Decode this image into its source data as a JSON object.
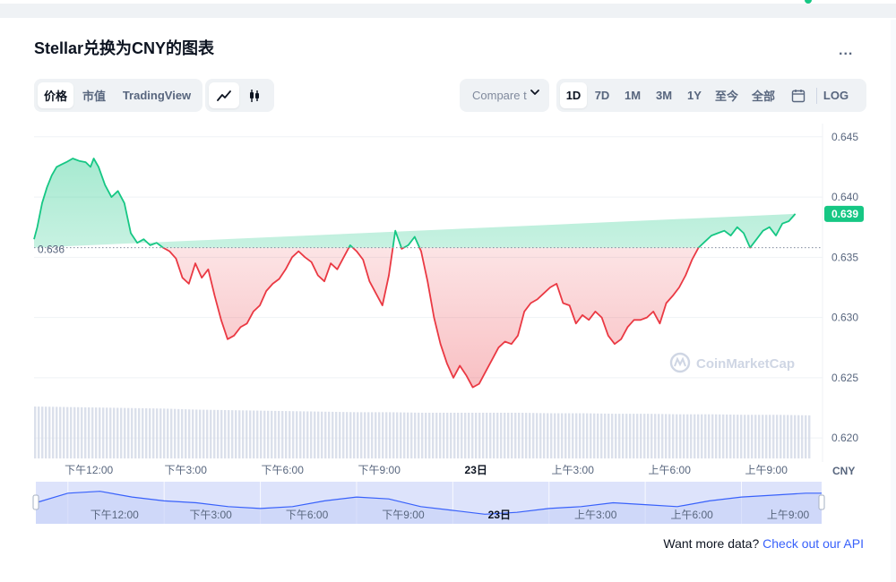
{
  "title": "Stellar兑换为CNY的图表",
  "more_label": "...",
  "view_tabs": [
    {
      "label": "价格",
      "active": true
    },
    {
      "label": "市值",
      "active": false
    },
    {
      "label": "TradingView",
      "active": false
    }
  ],
  "chart_type_icons": [
    "line-chart-icon",
    "candlestick-icon"
  ],
  "compare": {
    "label": "Compare t"
  },
  "range_tabs": [
    {
      "label": "1D",
      "active": true
    },
    {
      "label": "7D",
      "active": false
    },
    {
      "label": "1M",
      "active": false
    },
    {
      "label": "3M",
      "active": false
    },
    {
      "label": "1Y",
      "active": false
    },
    {
      "label": "至今",
      "active": false
    },
    {
      "label": "全部",
      "active": false
    }
  ],
  "log_label": "LOG",
  "footer": {
    "text": "Want more data?",
    "link": "Check out our API"
  },
  "watermark": "CoinMarketCap",
  "colors": {
    "up": "#16c784",
    "down": "#ea3943",
    "accent": "#3861fb",
    "volume": "#cfd6e4",
    "nav_fill": "#dde3fb"
  },
  "chart_data": {
    "type": "line",
    "currency_label": "CNY",
    "ylim": [
      0.6183,
      0.6461
    ],
    "yticks": [
      "0.645",
      "0.640",
      "0.635",
      "0.630",
      "0.625",
      "0.620"
    ],
    "ytick_values": [
      0.645,
      0.64,
      0.635,
      0.63,
      0.625,
      0.62
    ],
    "baseline": {
      "value": 0.6358,
      "label": "0.636"
    },
    "current": {
      "value": 0.6386,
      "label": "0.639"
    },
    "xticks": [
      "下午12:00",
      "下午3:00",
      "下午6:00",
      "下午9:00",
      "23日",
      "上午3:00",
      "上午6:00",
      "上午9:00"
    ],
    "xtick_hours": [
      1.7,
      4.7,
      7.7,
      10.7,
      13.7,
      16.7,
      19.7,
      22.7
    ],
    "x_hours_range": [
      0,
      24
    ],
    "price_x_hours": [
      0,
      0.1,
      0.25,
      0.4,
      0.55,
      0.7,
      0.85,
      1.0,
      1.2,
      1.4,
      1.6,
      1.75,
      1.85,
      2.0,
      2.2,
      2.4,
      2.6,
      2.8,
      3.0,
      3.2,
      3.4,
      3.6,
      3.8,
      4.0,
      4.2,
      4.4,
      4.6,
      4.8,
      5.0,
      5.2,
      5.4,
      5.6,
      5.8,
      6.0,
      6.2,
      6.4,
      6.6,
      6.8,
      7.0,
      7.2,
      7.4,
      7.6,
      7.8,
      8.0,
      8.2,
      8.4,
      8.6,
      8.8,
      9.0,
      9.2,
      9.4,
      9.6,
      9.8,
      10.0,
      10.2,
      10.4,
      10.6,
      10.8,
      11.0,
      11.2,
      11.4,
      11.6,
      11.8,
      12.0,
      12.2,
      12.4,
      12.6,
      12.8,
      13.0,
      13.2,
      13.4,
      13.6,
      13.8,
      14.0,
      14.2,
      14.4,
      14.6,
      14.8,
      15.0,
      15.2,
      15.4,
      15.6,
      15.8,
      16.0,
      16.2,
      16.4,
      16.6,
      16.8,
      17.0,
      17.2,
      17.4,
      17.6,
      17.8,
      18.0,
      18.2,
      18.4,
      18.6,
      18.8,
      19.0,
      19.2,
      19.4,
      19.6,
      19.8,
      20.0,
      20.2,
      20.4,
      20.6,
      20.8,
      21.0,
      21.2,
      21.4,
      21.6,
      21.8,
      22.0,
      22.2,
      22.4,
      22.6,
      22.8,
      23.0,
      23.2,
      23.4,
      23.6,
      23.8,
      24.0
    ],
    "price_values": [
      0.6365,
      0.6375,
      0.6395,
      0.6408,
      0.6418,
      0.6425,
      0.6427,
      0.6429,
      0.6432,
      0.643,
      0.6429,
      0.6425,
      0.6432,
      0.6425,
      0.641,
      0.64,
      0.6405,
      0.6395,
      0.637,
      0.6362,
      0.6365,
      0.636,
      0.6362,
      0.6358,
      0.6355,
      0.6349,
      0.6333,
      0.6328,
      0.6345,
      0.6333,
      0.634,
      0.6318,
      0.6298,
      0.6282,
      0.6285,
      0.6292,
      0.6295,
      0.6305,
      0.631,
      0.6322,
      0.6328,
      0.6332,
      0.634,
      0.635,
      0.6355,
      0.635,
      0.6346,
      0.6335,
      0.633,
      0.6345,
      0.634,
      0.635,
      0.636,
      0.6355,
      0.6348,
      0.633,
      0.632,
      0.631,
      0.6335,
      0.6372,
      0.6357,
      0.636,
      0.6367,
      0.6355,
      0.633,
      0.63,
      0.6278,
      0.6262,
      0.625,
      0.626,
      0.6252,
      0.6242,
      0.6245,
      0.6255,
      0.6265,
      0.6275,
      0.628,
      0.6278,
      0.6285,
      0.6305,
      0.6312,
      0.6315,
      0.632,
      0.6325,
      0.6328,
      0.6312,
      0.631,
      0.6295,
      0.6302,
      0.6298,
      0.6305,
      0.63,
      0.6285,
      0.6278,
      0.6282,
      0.6292,
      0.6298,
      0.6298,
      0.63,
      0.6305,
      0.6295,
      0.6312,
      0.6318,
      0.6325,
      0.6335,
      0.6348,
      0.6358,
      0.6363,
      0.6368,
      0.637,
      0.6372,
      0.6368,
      0.6375,
      0.637,
      0.6358,
      0.6365,
      0.6372,
      0.6375,
      0.6368,
      0.6378,
      0.638,
      0.6386
    ],
    "volume_x_hours": [
      0,
      1,
      2,
      3,
      4,
      5,
      6,
      7,
      8,
      9,
      10,
      11,
      12,
      13,
      14,
      15,
      16,
      17,
      18,
      19,
      20,
      21,
      22,
      23,
      24
    ],
    "volume_values": [
      1.0,
      0.99,
      0.98,
      0.97,
      0.96,
      0.94,
      0.93,
      0.92,
      0.91,
      0.9,
      0.89,
      0.89,
      0.88,
      0.88,
      0.88,
      0.88,
      0.87,
      0.87,
      0.86,
      0.86,
      0.85,
      0.85,
      0.84,
      0.84,
      0.83
    ],
    "navigator": {
      "xticks": [
        "下午12:00",
        "下午3:00",
        "下午6:00",
        "下午9:00",
        "23日",
        "上午3:00",
        "上午6:00",
        "上午9:00"
      ],
      "xtick_days": [
        0.5,
        3.5,
        6.5,
        9.5,
        12.5,
        15.5,
        18.5,
        21.5
      ],
      "x_days_range": [
        -0.5,
        24
      ],
      "x_days": [
        -0.5,
        0.5,
        1.5,
        2.5,
        3.5,
        4.5,
        5.5,
        6.5,
        7.5,
        8.5,
        9.5,
        10.5,
        11.5,
        12.5,
        13.5,
        14.5,
        15.5,
        16.5,
        17.5,
        18.5,
        19.5,
        20.5,
        21.5,
        22.5,
        23.5,
        24
      ],
      "values": [
        0.631,
        0.636,
        0.637,
        0.634,
        0.632,
        0.631,
        0.629,
        0.628,
        0.629,
        0.632,
        0.634,
        0.633,
        0.629,
        0.627,
        0.625,
        0.626,
        0.628,
        0.629,
        0.631,
        0.63,
        0.629,
        0.632,
        0.634,
        0.635,
        0.636,
        0.636
      ],
      "ylim": [
        0.62,
        0.642
      ]
    }
  }
}
